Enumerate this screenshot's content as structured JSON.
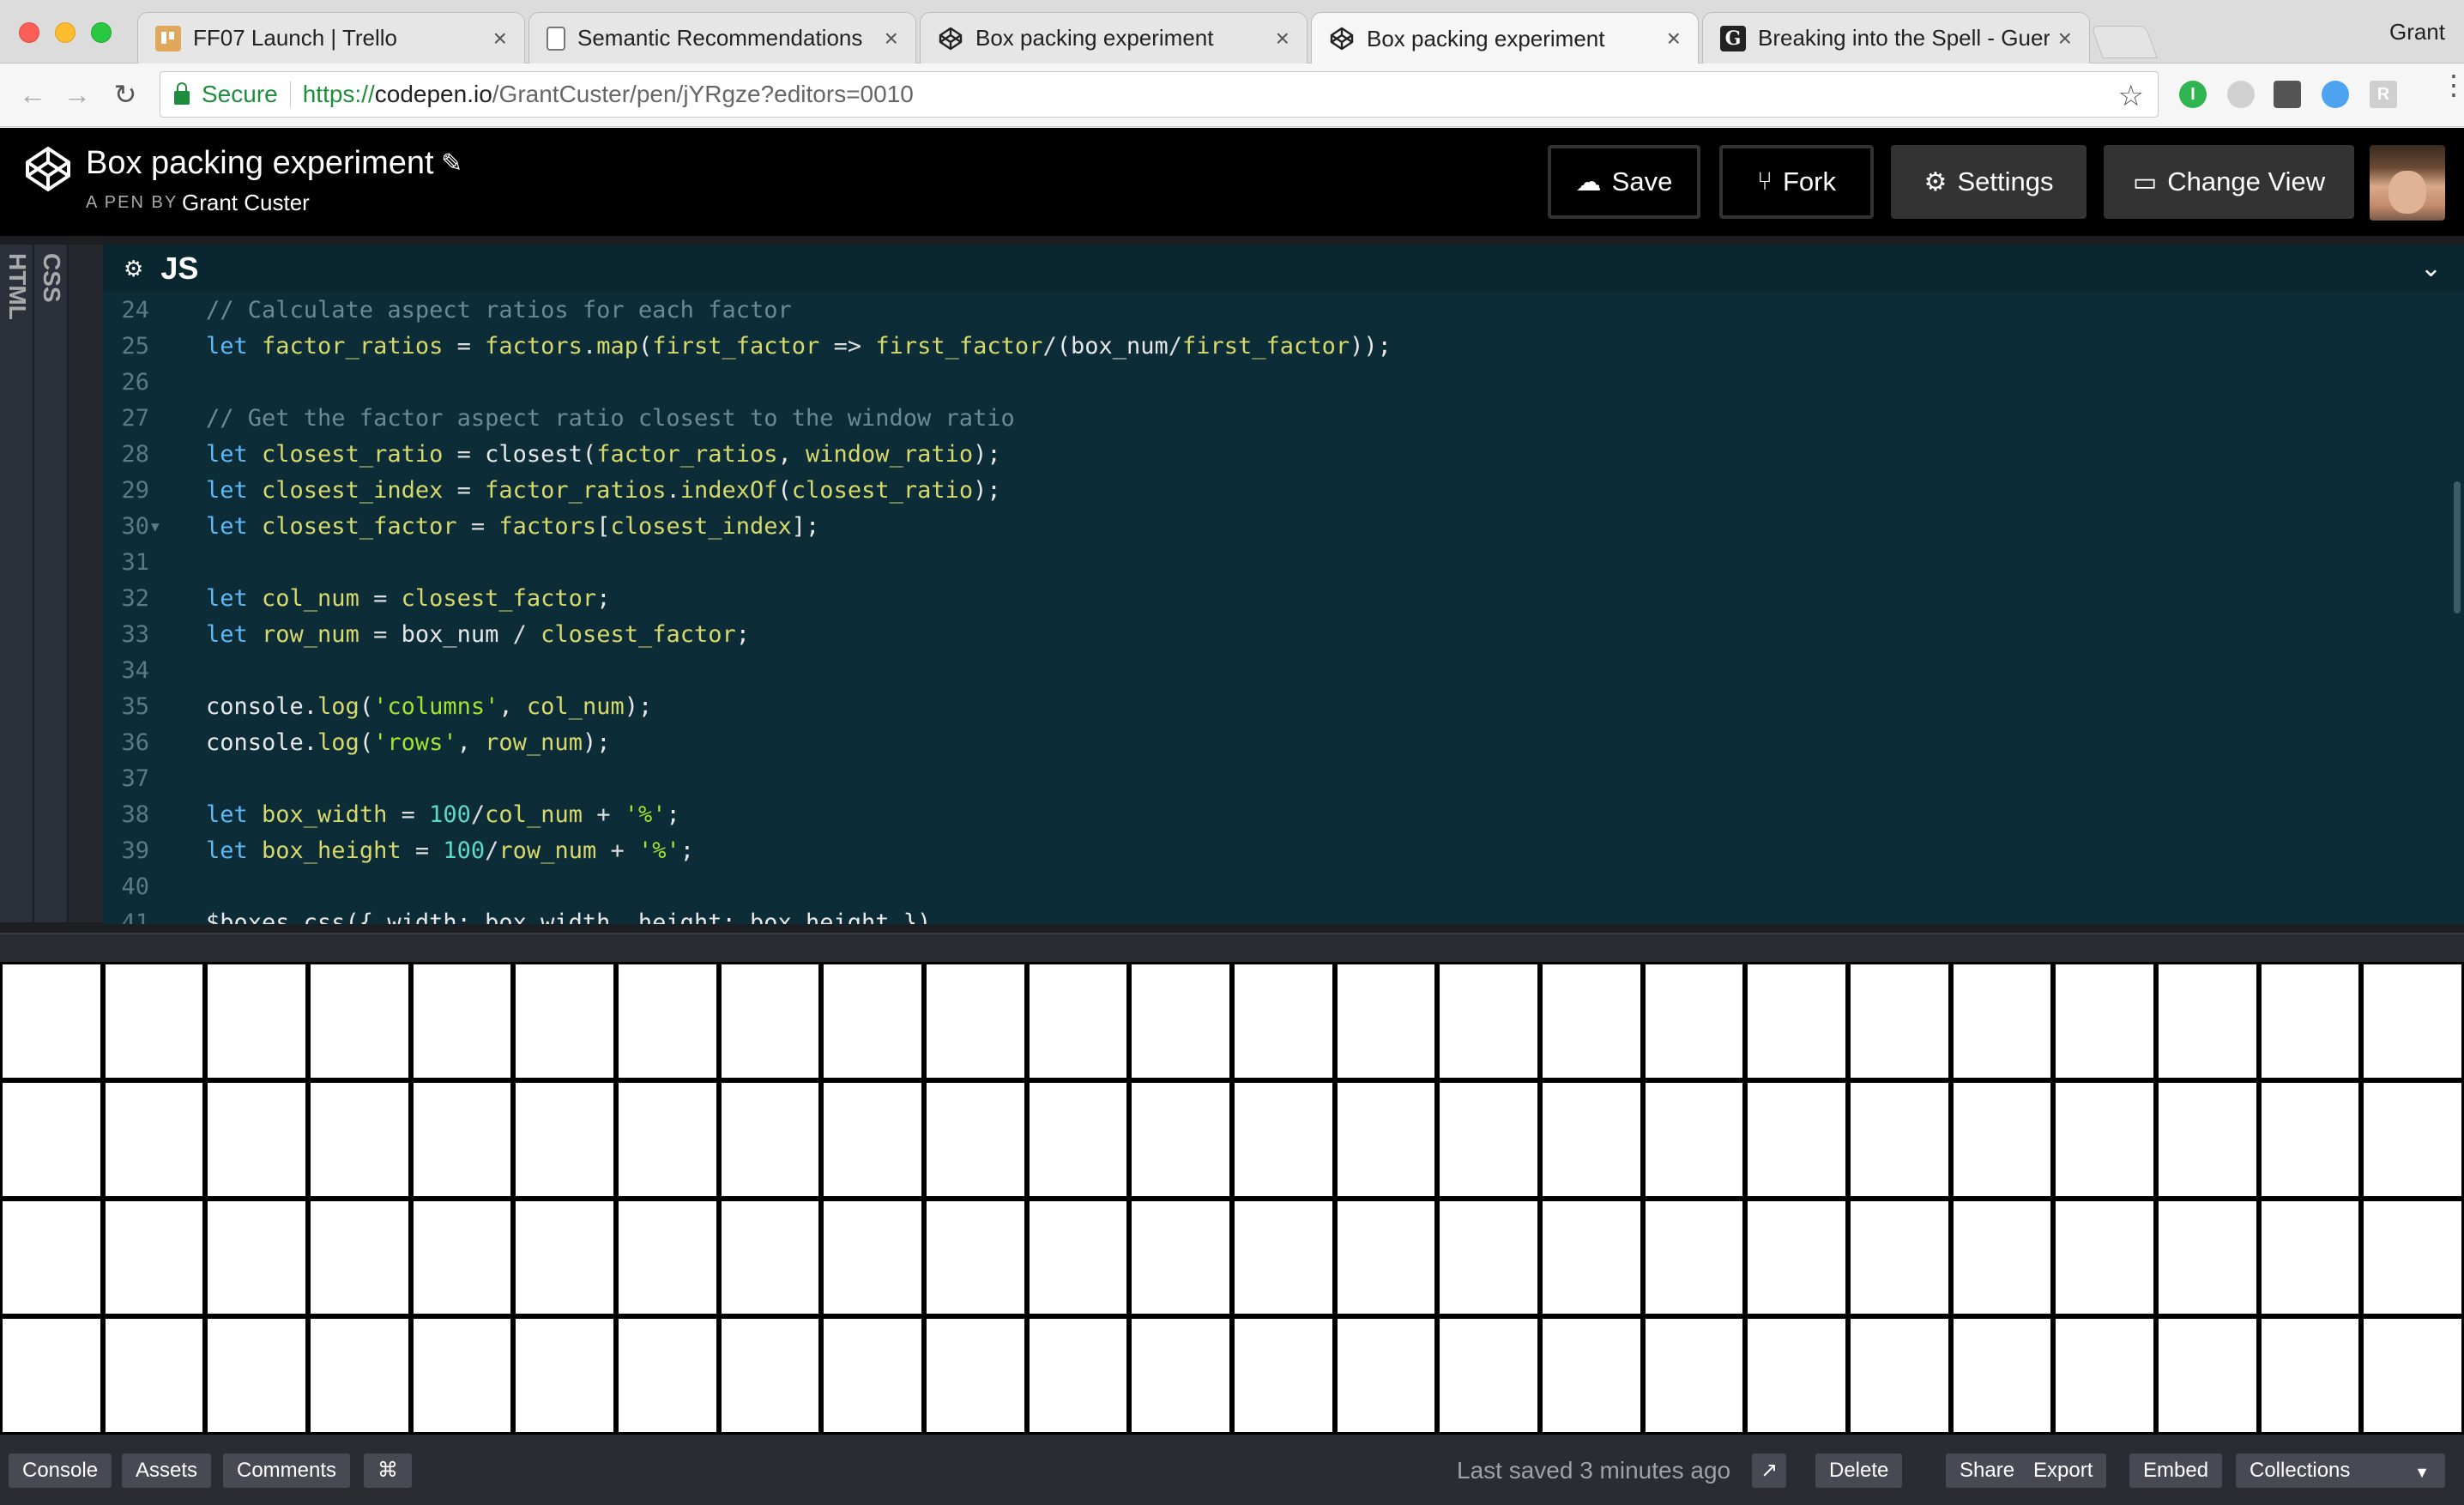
{
  "browser": {
    "tabs": [
      {
        "label": "FF07 Launch | Trello",
        "icon": "trello-icon"
      },
      {
        "label": "Semantic Recommendations",
        "icon": "document-icon"
      },
      {
        "label": "Box packing experiment",
        "icon": "codepen-icon"
      },
      {
        "label": "Box packing experiment",
        "icon": "codepen-icon",
        "active": true
      },
      {
        "label": "Breaking into the Spell - Guern",
        "icon": "guernica-icon"
      }
    ],
    "close_glyph": "×",
    "profile_name": "Grant",
    "secure_label": "Secure",
    "url": {
      "scheme": "https://",
      "host": "codepen.io",
      "path": "/GrantCuster/pen/jYRgze?editors=0010"
    }
  },
  "header": {
    "title": "Box packing experiment",
    "by_label": "A PEN BY",
    "author": "Grant Custer",
    "buttons": {
      "save": "Save",
      "fork": "Fork",
      "settings": "Settings",
      "change_view": "Change View"
    }
  },
  "editor": {
    "side_tabs": [
      "HTML",
      "CSS"
    ],
    "pane_title": "JS",
    "lines": [
      {
        "n": "24",
        "tokens": [
          [
            "comment",
            "// Calculate aspect ratios for each factor"
          ]
        ]
      },
      {
        "n": "25",
        "tokens": [
          [
            "kw",
            "let "
          ],
          [
            "var",
            "factor_ratios"
          ],
          [
            "op",
            " = "
          ],
          [
            "var",
            "factors"
          ],
          [
            "op",
            "."
          ],
          [
            "var",
            "map"
          ],
          [
            "plain",
            "("
          ],
          [
            "var",
            "first_factor"
          ],
          [
            "op",
            " => "
          ],
          [
            "var",
            "first_factor"
          ],
          [
            "op",
            "/"
          ],
          [
            "plain",
            "(box_num"
          ],
          [
            "op",
            "/"
          ],
          [
            "var",
            "first_factor"
          ],
          [
            "plain",
            "));"
          ]
        ]
      },
      {
        "n": "26",
        "tokens": []
      },
      {
        "n": "27",
        "tokens": [
          [
            "comment",
            "// Get the factor aspect ratio closest to the window ratio"
          ]
        ]
      },
      {
        "n": "28",
        "tokens": [
          [
            "kw",
            "let "
          ],
          [
            "var",
            "closest_ratio"
          ],
          [
            "op",
            " = "
          ],
          [
            "plain",
            "closest("
          ],
          [
            "var",
            "factor_ratios"
          ],
          [
            "plain",
            ", "
          ],
          [
            "var",
            "window_ratio"
          ],
          [
            "plain",
            ");"
          ]
        ]
      },
      {
        "n": "29",
        "tokens": [
          [
            "kw",
            "let "
          ],
          [
            "var",
            "closest_index"
          ],
          [
            "op",
            " = "
          ],
          [
            "var",
            "factor_ratios"
          ],
          [
            "op",
            "."
          ],
          [
            "var",
            "indexOf"
          ],
          [
            "plain",
            "("
          ],
          [
            "var",
            "closest_ratio"
          ],
          [
            "plain",
            ");"
          ]
        ]
      },
      {
        "n": "30",
        "fold": true,
        "tokens": [
          [
            "kw",
            "let "
          ],
          [
            "var",
            "closest_factor"
          ],
          [
            "op",
            " = "
          ],
          [
            "var",
            "factors"
          ],
          [
            "plain",
            "["
          ],
          [
            "var",
            "closest_index"
          ],
          [
            "plain",
            "];"
          ]
        ]
      },
      {
        "n": "31",
        "tokens": []
      },
      {
        "n": "32",
        "tokens": [
          [
            "kw",
            "let "
          ],
          [
            "var",
            "col_num"
          ],
          [
            "op",
            " = "
          ],
          [
            "var",
            "closest_factor"
          ],
          [
            "plain",
            ";"
          ]
        ]
      },
      {
        "n": "33",
        "tokens": [
          [
            "kw",
            "let "
          ],
          [
            "var",
            "row_num"
          ],
          [
            "op",
            " = "
          ],
          [
            "plain",
            "box_num "
          ],
          [
            "op",
            "/ "
          ],
          [
            "var",
            "closest_factor"
          ],
          [
            "plain",
            ";"
          ]
        ]
      },
      {
        "n": "34",
        "tokens": []
      },
      {
        "n": "35",
        "tokens": [
          [
            "plain",
            "console."
          ],
          [
            "var",
            "log"
          ],
          [
            "plain",
            "("
          ],
          [
            "str",
            "'columns'"
          ],
          [
            "plain",
            ", "
          ],
          [
            "var",
            "col_num"
          ],
          [
            "plain",
            ");"
          ]
        ]
      },
      {
        "n": "36",
        "tokens": [
          [
            "plain",
            "console."
          ],
          [
            "var",
            "log"
          ],
          [
            "plain",
            "("
          ],
          [
            "str",
            "'rows'"
          ],
          [
            "plain",
            ", "
          ],
          [
            "var",
            "row_num"
          ],
          [
            "plain",
            ");"
          ]
        ]
      },
      {
        "n": "37",
        "tokens": []
      },
      {
        "n": "38",
        "tokens": [
          [
            "kw",
            "let "
          ],
          [
            "var",
            "box_width"
          ],
          [
            "op",
            " = "
          ],
          [
            "num",
            "100"
          ],
          [
            "op",
            "/"
          ],
          [
            "var",
            "col_num"
          ],
          [
            "op",
            " + "
          ],
          [
            "str",
            "'%'"
          ],
          [
            "plain",
            ";"
          ]
        ]
      },
      {
        "n": "39",
        "tokens": [
          [
            "kw",
            "let "
          ],
          [
            "var",
            "box_height"
          ],
          [
            "op",
            " = "
          ],
          [
            "num",
            "100"
          ],
          [
            "op",
            "/"
          ],
          [
            "var",
            "row_num"
          ],
          [
            "op",
            " + "
          ],
          [
            "str",
            "'%'"
          ],
          [
            "plain",
            ";"
          ]
        ]
      },
      {
        "n": "40",
        "tokens": []
      },
      {
        "n": "41",
        "tokens": [
          [
            "plain",
            "$boxes.css({ width: box_width, height: box_height })"
          ]
        ]
      }
    ]
  },
  "preview": {
    "columns": 24,
    "rows": 4
  },
  "footer": {
    "left_buttons": [
      "Console",
      "Assets",
      "Comments",
      "⌘"
    ],
    "saved_text": "Last saved 3 minutes ago",
    "right_buttons": [
      "Delete",
      "Share",
      "Export",
      "Embed",
      "Collections"
    ]
  },
  "colors": {
    "editor_bg": "#0c2c38",
    "header_bg": "#000000",
    "footer_bg": "#2a2c31",
    "secure_green": "#1e8e3e"
  }
}
